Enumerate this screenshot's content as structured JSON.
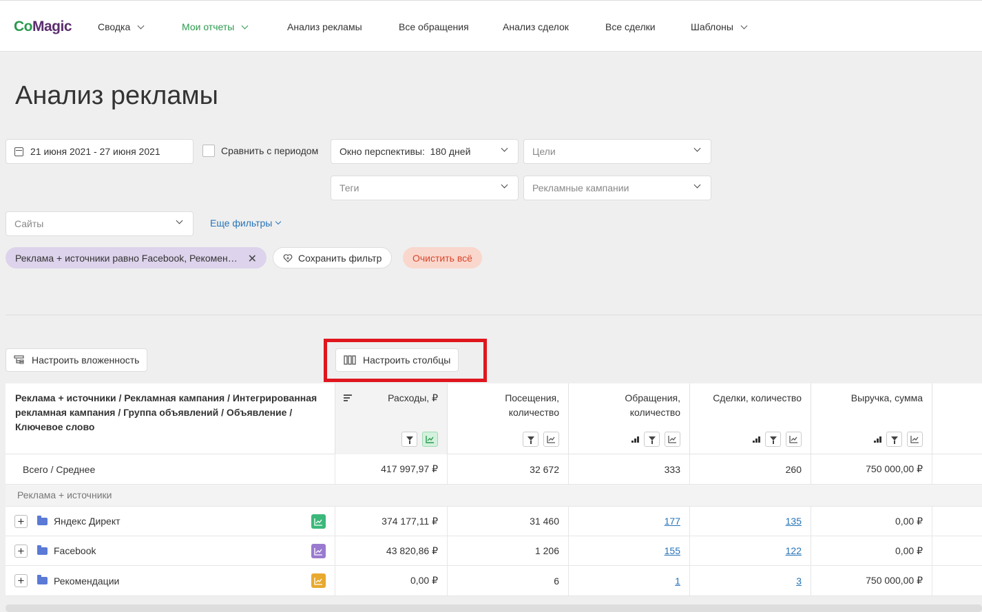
{
  "app": {
    "logo_co": "Co",
    "logo_magic": "Magic",
    "nav": [
      {
        "label": "Сводка",
        "dropdown": true
      },
      {
        "label": "Мои отчеты",
        "dropdown": true,
        "active": true
      },
      {
        "label": "Анализ рекламы"
      },
      {
        "label": "Все обращения"
      },
      {
        "label": "Анализ сделок"
      },
      {
        "label": "Все сделки"
      },
      {
        "label": "Шаблоны",
        "dropdown": true
      }
    ]
  },
  "page": {
    "title": "Анализ рекламы"
  },
  "filters": {
    "date_range": "21 июня 2021 - 27 июня 2021",
    "compare_label": "Сравнить с периодом",
    "window_label": "Окно перспективы:",
    "window_value": "180 дней",
    "goals_placeholder": "Цели",
    "tags_placeholder": "Теги",
    "campaigns_placeholder": "Рекламные кампании",
    "sites_placeholder": "Сайты",
    "more_filters": "Еще фильтры",
    "active_filter": "Реклама + источники равно Facebook, Рекомен…",
    "save_filter": "Сохранить фильтр",
    "clear_all": "Очистить всё"
  },
  "toolbar": {
    "nesting": "Настроить вложенность",
    "columns": "Настроить столбцы"
  },
  "table": {
    "headers": {
      "dimension": "Реклама + источники / Рекламная кампания / Интегрированная рекламная кампания / Группа объявлений / Объявление / Ключевое слово",
      "expenses": "Расходы, ₽",
      "visits_1": "Посещения,",
      "visits_2": "количество",
      "calls_1": "Обращения,",
      "calls_2": "количество",
      "deals": "Сделки, количество",
      "revenue": "Выручка, сумма"
    },
    "total": {
      "label": "Всего / Среднее",
      "expenses": "417 997,97 ₽",
      "visits": "32 672",
      "calls": "333",
      "deals": "260",
      "revenue": "750 000,00 ₽"
    },
    "group_label": "Реклама + источники",
    "rows": [
      {
        "name": "Яндекс Директ",
        "badge_color": "#3cb87a",
        "expenses": "374 177,11 ₽",
        "visits": "31 460",
        "calls": "177",
        "deals": "135",
        "revenue": "0,00 ₽"
      },
      {
        "name": "Facebook",
        "badge_color": "#9a7ad0",
        "expenses": "43 820,86 ₽",
        "visits": "1 206",
        "calls": "155",
        "deals": "122",
        "revenue": "0,00 ₽"
      },
      {
        "name": "Рекомендации",
        "badge_color": "#e8a92e",
        "expenses": "0,00 ₽",
        "visits": "6",
        "calls": "1",
        "deals": "3",
        "revenue": "750 000,00 ₽"
      }
    ]
  },
  "colors": {
    "accent_green": "#2a9a4e",
    "link_blue": "#2673b8",
    "highlight_red": "#e0161e"
  }
}
